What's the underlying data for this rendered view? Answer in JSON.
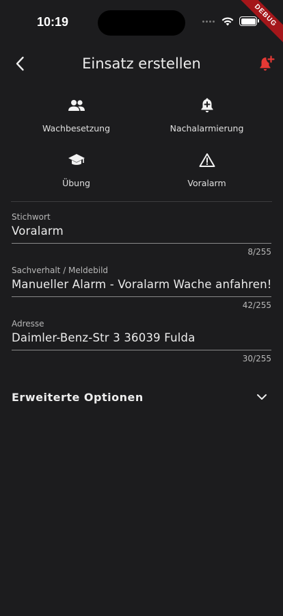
{
  "status_bar": {
    "time": "10:19"
  },
  "debug_banner": "DEBUG",
  "app_bar": {
    "title": "Einsatz erstellen"
  },
  "quick_actions": [
    {
      "label": "Wachbesetzung",
      "icon": "people-icon"
    },
    {
      "label": "Nachalarmierung",
      "icon": "bell-plus-icon"
    },
    {
      "label": "Übung",
      "icon": "graduation-cap-icon"
    },
    {
      "label": "Voralarm",
      "icon": "warning-triangle-icon"
    }
  ],
  "fields": {
    "stichwort": {
      "label": "Stichwort",
      "value": "Voralarm",
      "counter": "8/255"
    },
    "sachverhalt": {
      "label": "Sachverhalt / Meldebild",
      "value": "Manueller Alarm - Voralarm Wache anfahren!",
      "counter": "42/255"
    },
    "adresse": {
      "label": "Adresse",
      "value": "Daimler-Benz-Str 3 36039 Fulda",
      "counter": "30/255"
    }
  },
  "extended_options": {
    "label": "Erweiterte Optionen"
  },
  "colors": {
    "background": "#1c1c1e",
    "accent": "#e53935"
  }
}
